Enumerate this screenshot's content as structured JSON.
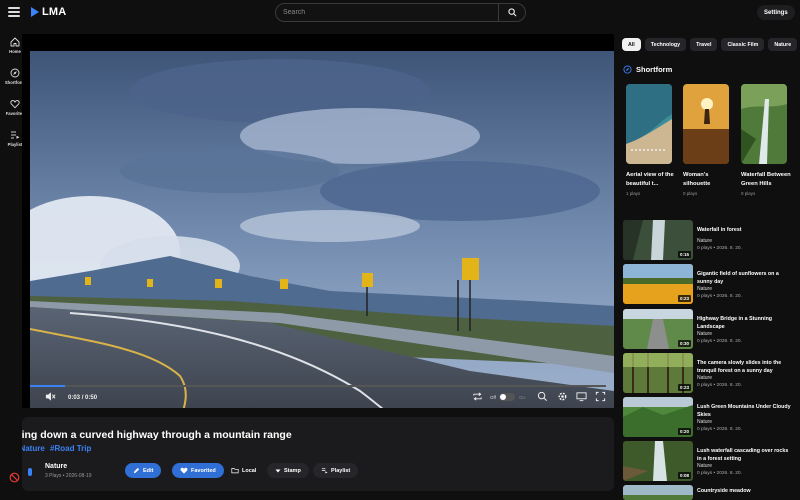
{
  "app": {
    "logo_text": "LMA",
    "accent": "#3b82f6"
  },
  "search": {
    "placeholder": "Search"
  },
  "header": {
    "settings_label": "Settings"
  },
  "nav": {
    "items": [
      {
        "label": "Home",
        "icon": "home-icon"
      },
      {
        "label": "Shortform",
        "icon": "compass-icon"
      },
      {
        "label": "Favorites",
        "icon": "heart-icon"
      },
      {
        "label": "Playlist",
        "icon": "playlist-icon"
      }
    ]
  },
  "player": {
    "current_time": "0:03",
    "separator": "/",
    "duration": "0:50",
    "progress": 0.06,
    "autoplay_label": "Off",
    "autoplay_state": "On"
  },
  "video": {
    "title": "Going down a curved highway through a mountain range",
    "tags": [
      "#Nature",
      "#Road Trip"
    ],
    "channel": "Nature",
    "meta": "3 Plays • 2026-08-19",
    "actions": {
      "edit": "Edit",
      "favorited": "Favorited",
      "local": "Local",
      "stamp": "Stamp",
      "playlist": "Playlist"
    }
  },
  "categories": [
    "All",
    "Technology",
    "Travel",
    "Classic Film",
    "Nature"
  ],
  "shortform": {
    "title": "Shortform",
    "items": [
      {
        "title": "Aerial view of the beautiful t...",
        "plays": "1 plays"
      },
      {
        "title": "Woman's silhouette walking...",
        "plays": "0 plays"
      },
      {
        "title": "Waterfall Between Green Hills",
        "plays": "0 plays"
      }
    ]
  },
  "related": [
    {
      "title": "Waterfall in forest",
      "channel": "Nature",
      "meta": "0 plays • 2026. 8. 20.",
      "duration": "0:15"
    },
    {
      "title": "Gigantic field of sunflowers on a sunny day",
      "channel": "Nature",
      "meta": "0 plays • 2026. 8. 20.",
      "duration": "0:23"
    },
    {
      "title": "Highway Bridge in a Stunning Landscape",
      "channel": "Nature",
      "meta": "0 plays • 2026. 8. 20.",
      "duration": "0:30"
    },
    {
      "title": "The camera slowly slides into the tranquil forest on a sunny day",
      "channel": "Nature",
      "meta": "0 plays • 2026. 8. 20.",
      "duration": "0:23"
    },
    {
      "title": "Lush Green Mountains Under Cloudy Skies",
      "channel": "Nature",
      "meta": "0 plays • 2026. 8. 20.",
      "duration": "0:20"
    },
    {
      "title": "Lush waterfall cascading over rocks in a forest setting",
      "channel": "Nature",
      "meta": "0 plays • 2026. 8. 20.",
      "duration": "0:08"
    },
    {
      "title": "Countryside meadow",
      "channel": "",
      "meta": "",
      "duration": ""
    }
  ]
}
